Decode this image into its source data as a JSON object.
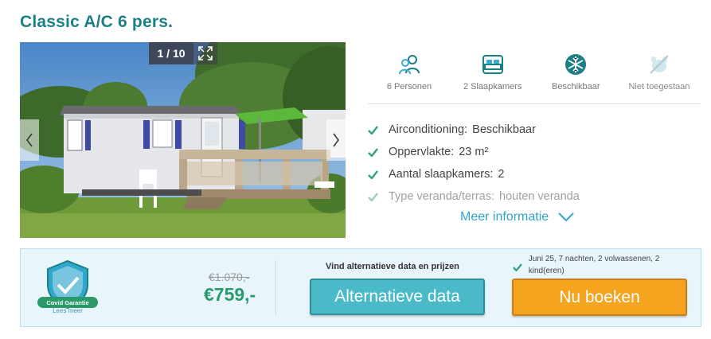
{
  "accommodation": {
    "title": "Classic A/C 6 pers."
  },
  "gallery": {
    "counter": "1 / 10"
  },
  "features": [
    {
      "icon": "persons-icon",
      "label": "6 Personen"
    },
    {
      "icon": "bedroom-icon",
      "label": "2 Slaapkamers"
    },
    {
      "icon": "snowflake-icon",
      "label": "Beschikbaar"
    },
    {
      "icon": "no-pets-icon",
      "label": "Niet toegestaan"
    }
  ],
  "specs": [
    {
      "label": "Airconditioning:",
      "value": "Beschikbaar"
    },
    {
      "label": "Oppervlakte:",
      "value": "23 m²"
    },
    {
      "label": "Aantal slaapkamers:",
      "value": "2"
    },
    {
      "label": "Type veranda/terras:",
      "value": "houten veranda"
    }
  ],
  "more_info": "Meer informatie",
  "booking": {
    "guarantee_label": "Covid Garantie",
    "guarantee_link": "Lees meer",
    "old_price": "€1.070,-",
    "price": "€759,-",
    "alt_caption": "Vind alternatieve data en prijzen",
    "alt_button": "Alternatieve data",
    "dates_summary": "Juni 25, 7 nachten, 2 volwassenen, 2 kind(eren)",
    "book_button": "Nu boeken"
  },
  "colors": {
    "title": "#1b7f86",
    "accent": "#2fa7cc",
    "price": "#2b9a6a",
    "alt_button": "#4ab9c8",
    "book_button": "#f5a420",
    "check": "#2fa37a"
  }
}
